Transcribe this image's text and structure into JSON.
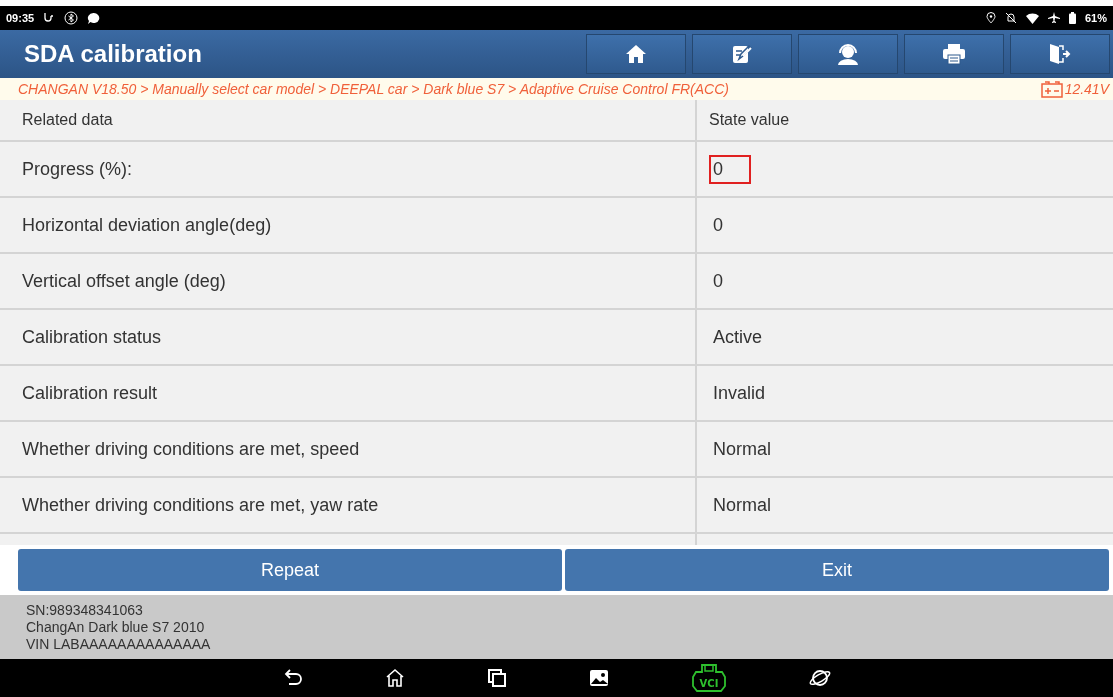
{
  "status_bar": {
    "time": "09:35",
    "battery": "61%"
  },
  "header": {
    "title": "SDA calibration"
  },
  "breadcrumb": {
    "path": "CHANGAN V18.50 > Manually select car model > DEEPAL car > Dark blue S7 > Adaptive Cruise Control FR(ACC)",
    "voltage": "12.41V"
  },
  "table": {
    "columns": [
      "Related data",
      "State value"
    ],
    "rows": [
      {
        "name": "Progress (%):",
        "value": "0",
        "highlighted": true
      },
      {
        "name": "Horizontal deviation angle(deg)",
        "value": "0",
        "highlighted": false
      },
      {
        "name": "Vertical offset angle (deg)",
        "value": "0",
        "highlighted": false
      },
      {
        "name": "Calibration status",
        "value": "Active",
        "highlighted": false
      },
      {
        "name": "Calibration result",
        "value": "Invalid",
        "highlighted": false
      },
      {
        "name": "Whether driving conditions are met, speed",
        "value": "Normal",
        "highlighted": false
      },
      {
        "name": "Whether driving conditions are met, yaw rate",
        "value": "Normal",
        "highlighted": false
      }
    ]
  },
  "buttons": [
    "Repeat",
    "Exit"
  ],
  "device_info": [
    "SN:989348341063",
    "ChangAn Dark blue S7 2010",
    "VIN LABAAAAAAAAAAAAAA"
  ],
  "nav_bar": {
    "vci_label": "VCI"
  }
}
